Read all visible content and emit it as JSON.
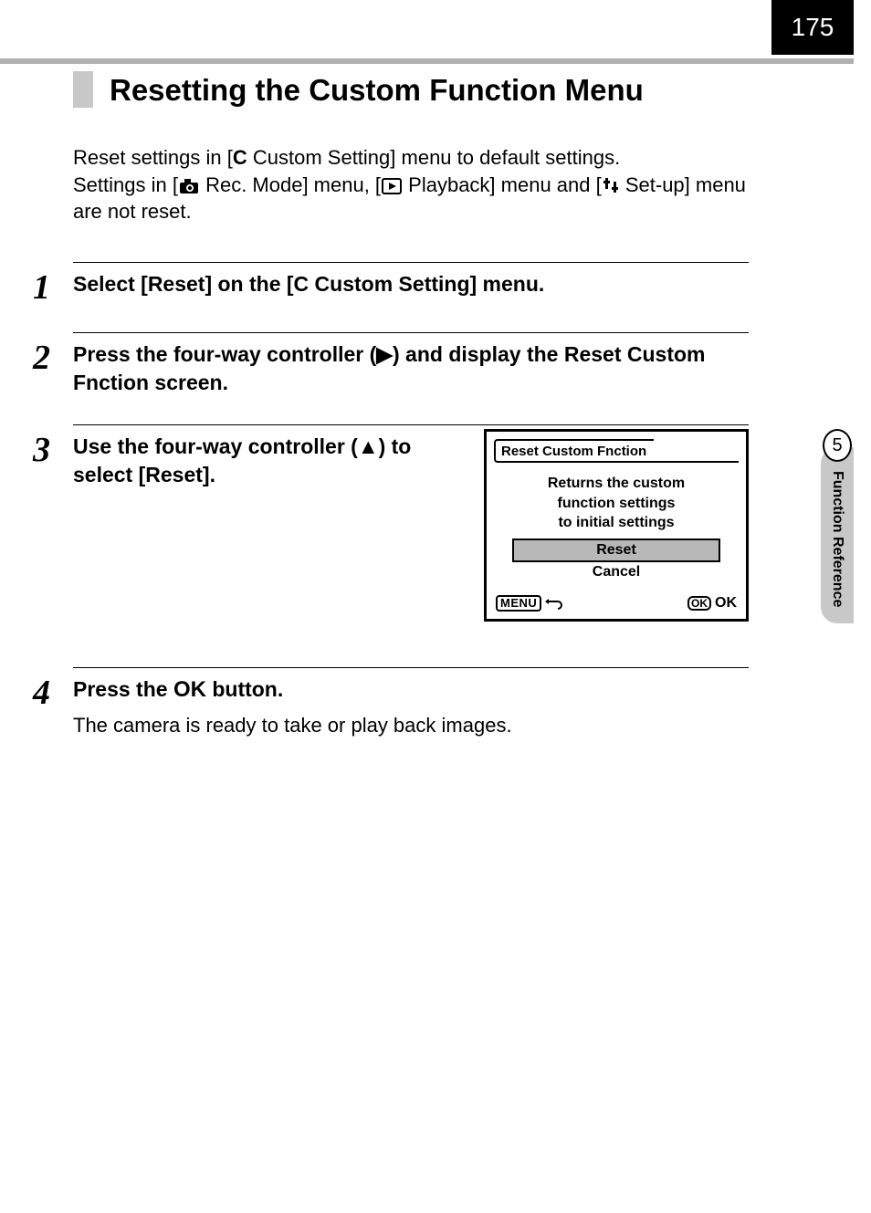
{
  "page_number": "175",
  "heading": "Resetting the Custom Function Menu",
  "intro": {
    "line1_pre": "Reset settings in [",
    "line1_csym": "C",
    "line1_post": " Custom Setting] menu to default settings.",
    "line2_p1": "Settings in [",
    "line2_p2": " Rec. Mode] menu, [",
    "line2_p3": " Playback] menu and [",
    "line2_p4": " Set-up] menu are not reset."
  },
  "steps": {
    "s1_num": "1",
    "s1_pre": "Select [Reset] on the [",
    "s1_csym": "C",
    "s1_post": " Custom Setting] menu.",
    "s2_num": "2",
    "s2_text": "Press the four-way controller (▶) and display the Reset Custom Fnction screen.",
    "s3_num": "3",
    "s3_text": "Use the four-way controller (▲) to select [Reset].",
    "s4_num": "4",
    "s4_pre": "Press the ",
    "s4_post": " button.",
    "s4_sub": "The camera is ready to take or play back images."
  },
  "screen": {
    "title": "Reset Custom Fnction",
    "msg_l1": "Returns the custom",
    "msg_l2": "function settings",
    "msg_l3": "to initial settings",
    "opt_reset": "Reset",
    "opt_cancel": "Cancel",
    "menu_label": "MENU",
    "ok_badge": "OK",
    "ok_text": "OK"
  },
  "sidebar": {
    "chapter_num": "5",
    "chapter_title": "Function Reference"
  }
}
